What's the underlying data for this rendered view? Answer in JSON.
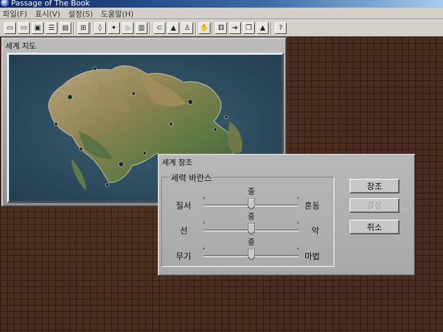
{
  "window": {
    "title": "Passage of The Book"
  },
  "menu": [
    {
      "label": "파일(F)"
    },
    {
      "label": "표시(V)"
    },
    {
      "label": "설정(S)"
    },
    {
      "label": "도움말(H)"
    }
  ],
  "toolbar": {
    "buttons": [
      {
        "icon": "window-icon",
        "glyph": "▭"
      },
      {
        "icon": "window-alt-icon",
        "glyph": "▭"
      },
      {
        "icon": "image-icon",
        "glyph": "▣"
      },
      {
        "icon": "list-icon",
        "glyph": "☰"
      },
      {
        "icon": "document-icon",
        "glyph": "▤"
      },
      {
        "icon": "grid-icon",
        "glyph": "⊞"
      },
      {
        "icon": "shield-icon",
        "glyph": "◊"
      },
      {
        "icon": "star-icon",
        "glyph": "✦"
      },
      {
        "icon": "potion-icon",
        "glyph": "♨"
      },
      {
        "icon": "chest-icon",
        "glyph": "▥"
      },
      {
        "icon": "scroll-icon",
        "glyph": "⊂"
      },
      {
        "icon": "castle-icon",
        "glyph": "▲"
      },
      {
        "icon": "person-icon",
        "glyph": "♙"
      },
      {
        "icon": "hand-icon",
        "glyph": "✋"
      },
      {
        "icon": "dice-icon",
        "glyph": "⚅"
      },
      {
        "icon": "arrow-right-icon",
        "glyph": "➔"
      },
      {
        "icon": "copy-icon",
        "glyph": "❐"
      },
      {
        "icon": "mountain-icon",
        "glyph": "▲"
      },
      {
        "icon": "help-icon",
        "glyph": "?"
      }
    ]
  },
  "map_window": {
    "title": "세계 지도"
  },
  "dialog": {
    "title": "세계 창조",
    "group_label": "세력 바란스",
    "sliders": [
      {
        "left": "질서",
        "right": "혼동",
        "center_label": "중",
        "value": 0.5
      },
      {
        "left": "선",
        "right": "악",
        "center_label": "중",
        "value": 0.5
      },
      {
        "left": "무기",
        "right": "마법",
        "center_label": "중",
        "value": 0.5
      }
    ],
    "buttons": {
      "create": "창조",
      "decide": "결정",
      "cancel": "취소"
    }
  }
}
